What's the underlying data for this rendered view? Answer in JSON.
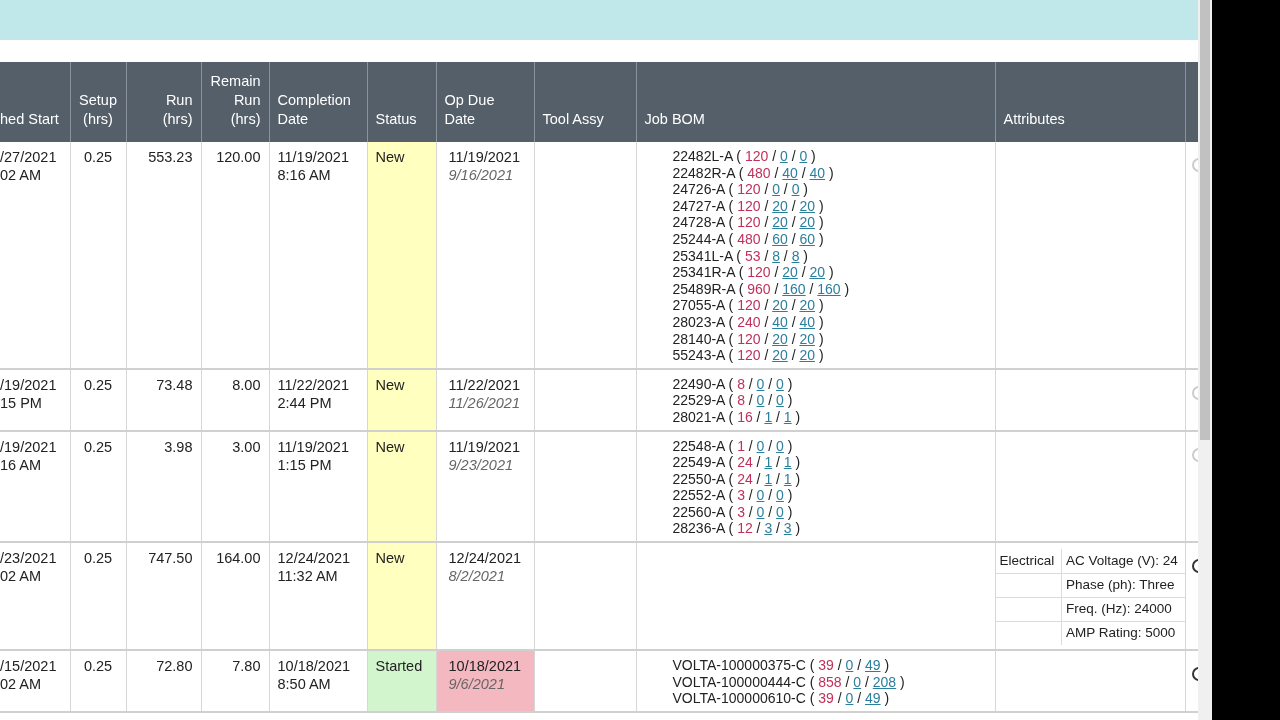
{
  "table": {
    "columns": [
      {
        "label": "hed Start"
      },
      {
        "label": "Setup (hrs)"
      },
      {
        "label": "Run (hrs)"
      },
      {
        "label": "Remain Run (hrs)"
      },
      {
        "label": "Completion Date"
      },
      {
        "label": "Status"
      },
      {
        "label": "Op Due Date"
      },
      {
        "label": "Tool Assy"
      },
      {
        "label": "Job BOM"
      },
      {
        "label": "Attributes"
      }
    ],
    "rows": [
      {
        "start": [
          "/27/2021",
          "02 AM"
        ],
        "setup": "0.25",
        "run": "553.23",
        "remain": "120.00",
        "completion": [
          "11/19/2021",
          "8:16 AM"
        ],
        "status": {
          "text": "New",
          "color": "#ffffc0"
        },
        "op_due": "11/19/2021",
        "op_due_original": "9/16/2021",
        "overdue": false,
        "action_active": false,
        "bom": [
          {
            "part": "22482L-A",
            "open": "(",
            "qty": "120",
            "sep1": "/",
            "a": "0",
            "sep2": "/",
            "b": "0",
            "close": ")"
          },
          {
            "part": "22482R-A",
            "open": "(",
            "qty": "480",
            "sep1": "/",
            "a": "40",
            "sep2": "/",
            "b": "40",
            "close": ")"
          },
          {
            "part": "24726-A",
            "open": "(",
            "qty": "120",
            "sep1": "/",
            "a": "0",
            "sep2": "/",
            "b": "0",
            "close": ")"
          },
          {
            "part": "24727-A",
            "open": "(",
            "qty": "120",
            "sep1": "/",
            "a": "20",
            "sep2": "/",
            "b": "20",
            "close": ")"
          },
          {
            "part": "24728-A",
            "open": "(",
            "qty": "120",
            "sep1": "/",
            "a": "20",
            "sep2": "/",
            "b": "20",
            "close": ")"
          },
          {
            "part": "25244-A",
            "open": "(",
            "qty": "480",
            "sep1": "/",
            "a": "60",
            "sep2": "/",
            "b": "60",
            "close": ")"
          },
          {
            "part": "25341L-A",
            "open": "(",
            "qty": "53",
            "sep1": "/",
            "a": "8",
            "sep2": "/",
            "b": "8",
            "close": ")"
          },
          {
            "part": "25341R-A",
            "open": "(",
            "qty": "120",
            "sep1": "/",
            "a": "20",
            "sep2": "/",
            "b": "20",
            "close": ")"
          },
          {
            "part": "25489R-A",
            "open": "(",
            "qty": "960",
            "sep1": "/",
            "a": "160",
            "sep2": "/",
            "b": "160",
            "close": ")"
          },
          {
            "part": "27055-A",
            "open": "(",
            "qty": "120",
            "sep1": "/",
            "a": "20",
            "sep2": "/",
            "b": "20",
            "close": ")"
          },
          {
            "part": "28023-A",
            "open": "(",
            "qty": "240",
            "sep1": "/",
            "a": "40",
            "sep2": "/",
            "b": "40",
            "close": ")"
          },
          {
            "part": "28140-A",
            "open": "(",
            "qty": "120",
            "sep1": "/",
            "a": "20",
            "sep2": "/",
            "b": "20",
            "close": ")"
          },
          {
            "part": "55243-A",
            "open": "(",
            "qty": "120",
            "sep1": "/",
            "a": "20",
            "sep2": "/",
            "b": "20",
            "close": ")"
          }
        ]
      },
      {
        "start": [
          "/19/2021",
          "15 PM"
        ],
        "setup": "0.25",
        "run": "73.48",
        "remain": "8.00",
        "completion": [
          "11/22/2021",
          "2:44 PM"
        ],
        "status": {
          "text": "New",
          "color": "#ffffc0"
        },
        "op_due": "11/22/2021",
        "op_due_original": "11/26/2021",
        "overdue": false,
        "action_active": false,
        "bom": [
          {
            "part": "22490-A",
            "open": "(",
            "qty": "8",
            "sep1": "/",
            "a": "0",
            "sep2": "/",
            "b": "0",
            "close": ")"
          },
          {
            "part": "22529-A",
            "open": "(",
            "qty": "8",
            "sep1": "/",
            "a": "0",
            "sep2": "/",
            "b": "0",
            "close": ")"
          },
          {
            "part": "28021-A",
            "open": "(",
            "qty": "16",
            "sep1": "/",
            "a": "1",
            "sep2": "/",
            "b": "1",
            "close": ")"
          }
        ]
      },
      {
        "start": [
          "/19/2021",
          "16 AM"
        ],
        "setup": "0.25",
        "run": "3.98",
        "remain": "3.00",
        "completion": [
          "11/19/2021",
          "1:15 PM"
        ],
        "status": {
          "text": "New",
          "color": "#ffffc0"
        },
        "op_due": "11/19/2021",
        "op_due_original": "9/23/2021",
        "overdue": false,
        "action_active": false,
        "bom": [
          {
            "part": "22548-A",
            "open": "(",
            "qty": "1",
            "sep1": "/",
            "a": "0",
            "sep2": "/",
            "b": "0",
            "close": ")"
          },
          {
            "part": "22549-A",
            "open": "(",
            "qty": "24",
            "sep1": "/",
            "a": "1",
            "sep2": "/",
            "b": "1",
            "close": ")"
          },
          {
            "part": "22550-A",
            "open": "(",
            "qty": "24",
            "sep1": "/",
            "a": "1",
            "sep2": "/",
            "b": "1",
            "close": ")"
          },
          {
            "part": "22552-A",
            "open": "(",
            "qty": "3",
            "sep1": "/",
            "a": "0",
            "sep2": "/",
            "b": "0",
            "close": ")"
          },
          {
            "part": "22560-A",
            "open": "(",
            "qty": "3",
            "sep1": "/",
            "a": "0",
            "sep2": "/",
            "b": "0",
            "close": ")"
          },
          {
            "part": "28236-A",
            "open": "(",
            "qty": "12",
            "sep1": "/",
            "a": "3",
            "sep2": "/",
            "b": "3",
            "close": ")"
          }
        ]
      },
      {
        "start": [
          "/23/2021",
          "02 AM"
        ],
        "setup": "0.25",
        "run": "747.50",
        "remain": "164.00",
        "completion": [
          "12/24/2021",
          "11:32 AM"
        ],
        "status": {
          "text": "New",
          "color": "#ffffc0"
        },
        "op_due": "12/24/2021",
        "op_due_original": "8/2/2021",
        "overdue": false,
        "action_active": true,
        "attributes": [
          {
            "group": "Electrical",
            "text": "AC Voltage (V): 24"
          },
          {
            "text": "Phase (ph): Three"
          },
          {
            "text": "Freq. (Hz): 24000"
          },
          {
            "text": "AMP Rating: 5000"
          }
        ]
      },
      {
        "start": [
          "/15/2021",
          "02 AM"
        ],
        "setup": "0.25",
        "run": "72.80",
        "remain": "7.80",
        "completion": [
          "10/18/2021",
          "8:50 AM"
        ],
        "status": {
          "text": "Started",
          "color": "#d3f5cd"
        },
        "op_due": "10/18/2021",
        "op_due_original": "9/6/2021",
        "overdue": true,
        "action_active": true,
        "bom": [
          {
            "part": "VOLTA-100000375-C",
            "open": "(",
            "qty": "39",
            "sep1": "/",
            "a": "0",
            "sep2": "/",
            "b": "49",
            "close": ")"
          },
          {
            "part": "VOLTA-100000444-C",
            "open": "(",
            "qty": "858",
            "sep1": "/",
            "a": "0",
            "sep2": "/",
            "b": "208",
            "close": ")"
          },
          {
            "part": "VOLTA-100000610-C",
            "open": "(",
            "qty": "39",
            "sep1": "/",
            "a": "0",
            "sep2": "/",
            "b": "49",
            "close": ")"
          }
        ]
      }
    ]
  }
}
